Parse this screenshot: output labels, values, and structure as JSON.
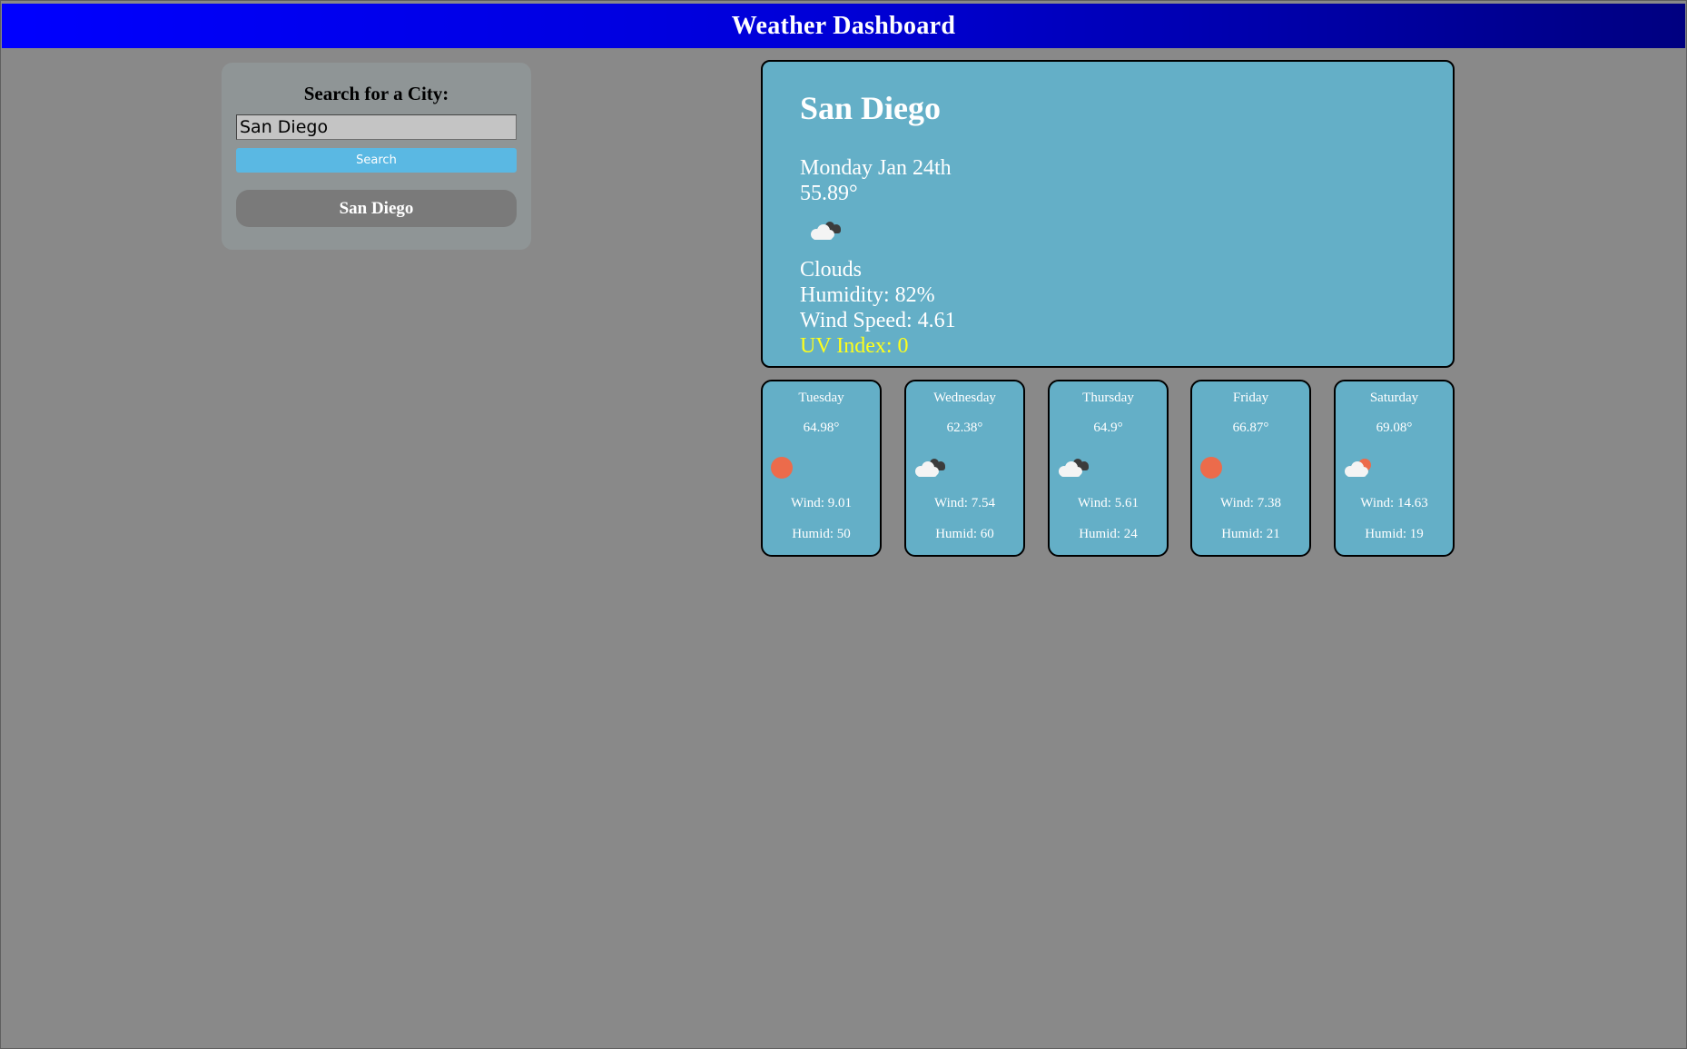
{
  "header": {
    "title": "Weather Dashboard"
  },
  "search": {
    "title": "Search for a City:",
    "input_value": "San Diego",
    "button_label": "Search",
    "history": [
      "San Diego"
    ]
  },
  "current": {
    "city": "San Diego",
    "date": "Monday Jan 24th",
    "temp": "55.89°",
    "icon": "broken-clouds-icon",
    "condition": "Clouds",
    "humidity": "Humidity: 82%",
    "wind": "Wind Speed: 4.61",
    "uv": "UV Index: 0"
  },
  "forecast": [
    {
      "day": "Tuesday",
      "temp": "64.98°",
      "icon": "sun-icon",
      "wind": "Wind: 9.01",
      "humid": "Humid: 50"
    },
    {
      "day": "Wednesday",
      "temp": "62.38°",
      "icon": "broken-clouds-icon",
      "wind": "Wind: 7.54",
      "humid": "Humid: 60"
    },
    {
      "day": "Thursday",
      "temp": "64.9°",
      "icon": "broken-clouds-icon",
      "wind": "Wind: 5.61",
      "humid": "Humid: 24"
    },
    {
      "day": "Friday",
      "temp": "66.87°",
      "icon": "sun-icon",
      "wind": "Wind: 7.38",
      "humid": "Humid: 21"
    },
    {
      "day": "Saturday",
      "temp": "69.08°",
      "icon": "sun-cloud-icon",
      "wind": "Wind: 14.63",
      "humid": "Humid: 19"
    }
  ],
  "colors": {
    "card_bg": "#64afc7",
    "uv_text": "#ffff1a",
    "search_button": "#5ab8e3",
    "sun": "#ec6b4b"
  }
}
